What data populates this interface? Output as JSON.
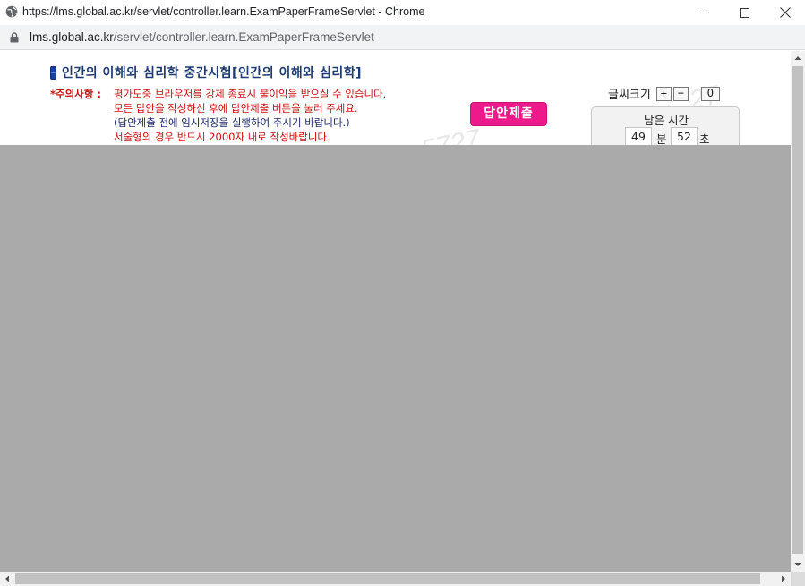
{
  "window": {
    "title": "https://lms.global.ac.kr/servlet/controller.learn.ExamPaperFrameServlet - Chrome"
  },
  "address_bar": {
    "host": "lms.global.ac.kr",
    "path": "/servlet/controller.learn.ExamPaperFrameServlet"
  },
  "exam": {
    "title": "인간의 이해와 심리학 중간시험[인간의 이해와 심리학]",
    "notice_label": "*주의사항 :",
    "notice_lines": [
      "평가도중 브라우저를 강제 종료시 불이익을 받으실 수 있습니다.",
      "모든 답안을 작성하신 후에 답안제출 버튼을 눌러 주세요.",
      "(답안제출 전에 임시저장을 실행하여 주시기 바랍니다.)",
      "서술형의 경우 반드시 2000자 내로 작성바랍니다."
    ],
    "submit_label": "답안제출"
  },
  "font_size": {
    "label": "글씨크기",
    "increase": "+",
    "decrease": "−",
    "reset": "O"
  },
  "timer": {
    "label": "남은 시간",
    "minutes": "49",
    "minutes_unit": "분",
    "seconds": "52",
    "seconds_unit": "초"
  },
  "icons": {
    "window": "globe-icon",
    "address": "lock-icon",
    "title": "pill-icon"
  }
}
